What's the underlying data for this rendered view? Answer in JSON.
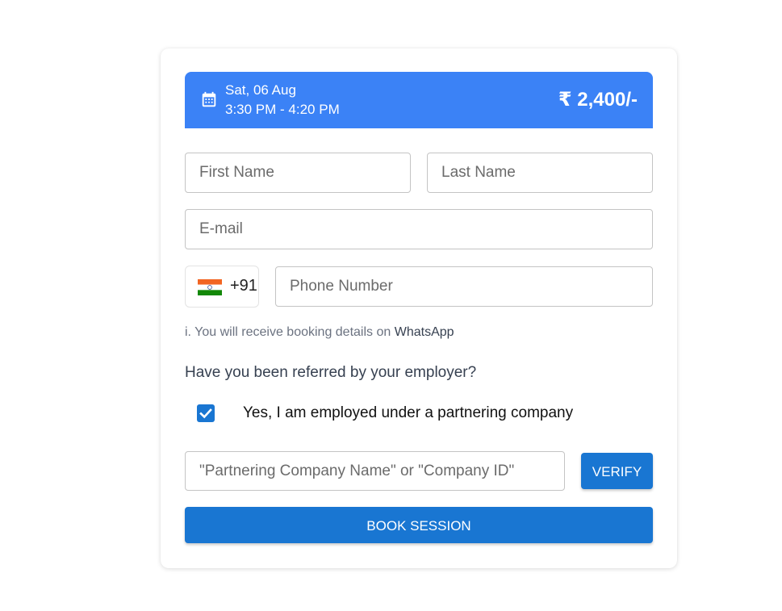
{
  "booking": {
    "date": "Sat, 06 Aug",
    "time": "3:30 PM - 4:20 PM",
    "price": "₹ 2,400/-",
    "calendar_icon": "calendar-icon"
  },
  "form": {
    "first_name_placeholder": "First Name",
    "last_name_placeholder": "Last Name",
    "email_placeholder": "E-mail",
    "country_flag": "india-flag-icon",
    "country_code": "+91",
    "phone_placeholder": "Phone Number",
    "whatsapp_note_prefix": "i. You will receive booking details on ",
    "whatsapp_note_brand": "WhatsApp",
    "referral_question": "Have you been referred by your employer?",
    "referral_checkbox_label": "Yes, I am employed under a partnering company",
    "referral_checked": true,
    "company_placeholder": "\"Partnering Company Name\" or \"Company ID\"",
    "verify_label": "VERIFY",
    "book_label": "BOOK SESSION"
  },
  "colors": {
    "banner": "#3b82f6",
    "primary": "#1976d2"
  }
}
